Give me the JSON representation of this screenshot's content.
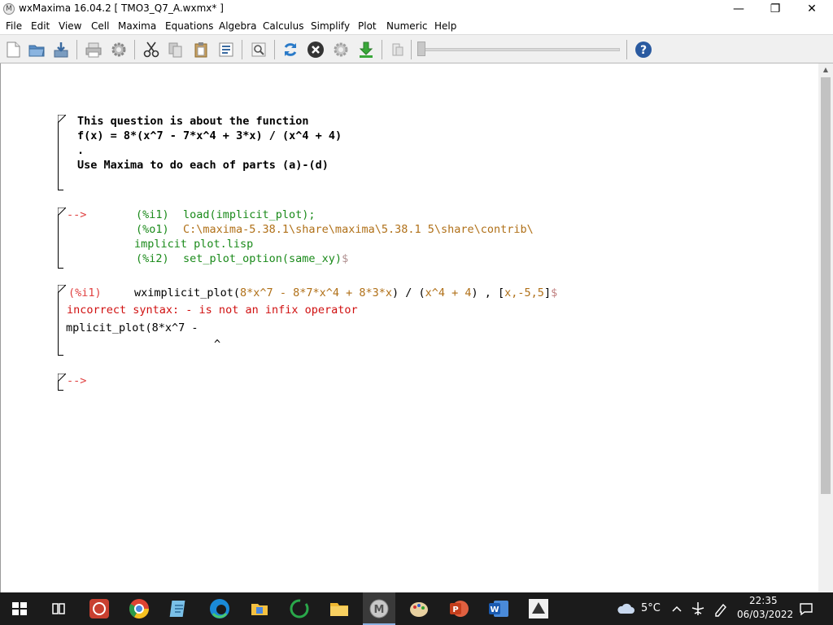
{
  "window": {
    "title": "wxMaxima 16.04.2  [ TMO3_Q7_A.wxmx* ]",
    "icon_glyph": "M",
    "controls": {
      "minimize": "—",
      "maximize": "❐",
      "close": "✕"
    }
  },
  "menu": [
    "File",
    "Edit",
    "View",
    "Cell",
    "Maxima",
    "Equations",
    "Algebra",
    "Calculus",
    "Simplify",
    "Plot",
    "Numeric",
    "Help"
  ],
  "toolbar": {
    "icons": [
      "new-document-icon",
      "open-folder-icon",
      "save-icon",
      "print-icon",
      "preferences-gear-icon",
      "cut-scissors-icon",
      "copy-icon",
      "paste-icon",
      "select-all-icon",
      "find-icon",
      "refresh-icon",
      "interrupt-icon",
      "gear-icon",
      "download-arrow-icon",
      "animation-icon",
      "help-icon"
    ],
    "help_glyph": "?"
  },
  "cells": {
    "text_cell": {
      "lines": [
        "This question is about the function",
        "f(x) = 8*(x^7 - 7*x^4 + 3*x) / (x^4 + 4)",
        ".",
        "Use Maxima to do each of parts (a)-(d)"
      ]
    },
    "cell2": {
      "prompt": "-->",
      "in1_label": "(%i1)",
      "in1_code": "load(implicit_plot);",
      "out1_label": "(%o1)",
      "out1_path": "C:\\maxima-5.38.1\\share\\maxima\\5.38.1 5\\share\\contrib\\",
      "out1_path_cont": "implicit plot.lisp",
      "in2_label": "(%i2)",
      "in2_code": "set_plot_option(same_xy)",
      "in2_end": "$"
    },
    "cell3": {
      "in_label": "(%i1)",
      "code_a": "wximplicit_plot(",
      "code_b": "8*x^7 - 8*7*x^4 + 8*3*x",
      "code_c": ") / (",
      "code_d": "x^4 + 4",
      "code_e": ") , [",
      "code_f": "x,-5,5",
      "code_g": "]",
      "code_end": "$",
      "error_msg": "incorrect syntax: - is not an infix operator",
      "error_context": "mplicit_plot(8*x^7 -",
      "error_caret": "^"
    },
    "cell4": {
      "prompt": "-->"
    }
  },
  "taskbar": {
    "apps": [
      "windows-start-icon",
      "task-view-icon",
      "cabri-icon",
      "chrome-icon",
      "notepad-icon",
      "edge-icon",
      "file-explorer-icon",
      "refresh-app-icon",
      "folder-icon",
      "wxmaxima-icon",
      "paint-icon",
      "powerpoint-icon",
      "word-icon",
      "app-icon"
    ],
    "weather": "5°C",
    "time": "22:35",
    "date": "06/03/2022"
  }
}
